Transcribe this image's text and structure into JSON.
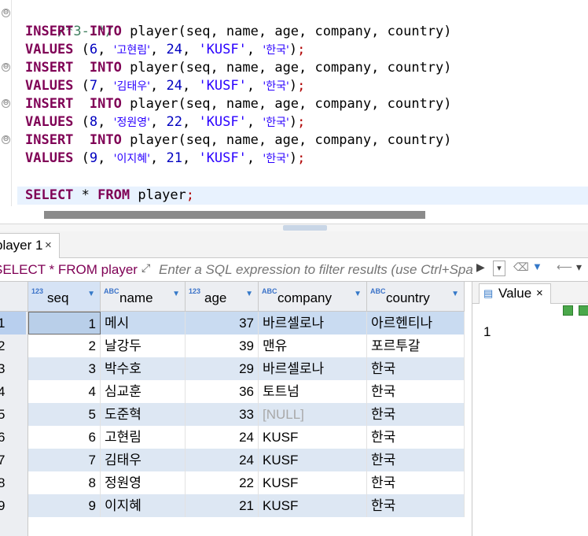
{
  "editor": {
    "comment": "/*3-1*/",
    "lines": [
      {
        "kw1": "INSERT",
        "kw2": "INTO",
        "rest": "player(seq, name, age, company, country)"
      },
      {
        "kw": "VALUES",
        "open": "(",
        "num1": "6",
        "str1": "'고현림'",
        "num2": "24",
        "str2": "'KUSF'",
        "str3": "'한국'",
        "close": ")",
        "semi": ";"
      },
      {
        "kw1": "INSERT",
        "kw2": "INTO",
        "rest": "player(seq, name, age, company, country)"
      },
      {
        "kw": "VALUES",
        "open": "(",
        "num1": "7",
        "str1": "'김태우'",
        "num2": "24",
        "str2": "'KUSF'",
        "str3": "'한국'",
        "close": ")",
        "semi": ";"
      },
      {
        "kw1": "INSERT",
        "kw2": "INTO",
        "rest": "player(seq, name, age, company, country)"
      },
      {
        "kw": "VALUES",
        "open": "(",
        "num1": "8",
        "str1": "'정원영'",
        "num2": "22",
        "str2": "'KUSF'",
        "str3": "'한국'",
        "close": ")",
        "semi": ";"
      },
      {
        "kw1": "INSERT",
        "kw2": "INTO",
        "rest": "player(seq, name, age, company, country)"
      },
      {
        "kw": "VALUES",
        "open": "(",
        "num1": "9",
        "str1": "'이지혜'",
        "num2": "21",
        "str2": "'KUSF'",
        "str3": "'한국'",
        "close": ")",
        "semi": ";"
      }
    ],
    "select": {
      "kw1": "SELECT",
      "star": "*",
      "kw2": "FROM",
      "table": "player",
      "semi": ";"
    }
  },
  "result_tab": {
    "label": "player 1",
    "close": "×"
  },
  "filter": {
    "query_label": "SELECT * FROM player",
    "placeholder": "Enter a SQL expression to filter results (use Ctrl+Space)"
  },
  "grid": {
    "columns": [
      {
        "name": "seq",
        "type": "123"
      },
      {
        "name": "name",
        "type": "ABC"
      },
      {
        "name": "age",
        "type": "123"
      },
      {
        "name": "company",
        "type": "ABC"
      },
      {
        "name": "country",
        "type": "ABC"
      }
    ],
    "rows": [
      {
        "num": "1",
        "seq": "1",
        "name": "메시",
        "age": "37",
        "company": "바르셀로나",
        "country": "아르헨티나"
      },
      {
        "num": "2",
        "seq": "2",
        "name": "날강두",
        "age": "39",
        "company": "맨유",
        "country": "포르투갈"
      },
      {
        "num": "3",
        "seq": "3",
        "name": "박수호",
        "age": "29",
        "company": "바르셀로나",
        "country": "한국"
      },
      {
        "num": "4",
        "seq": "4",
        "name": "심교훈",
        "age": "36",
        "company": "토트넘",
        "country": "한국"
      },
      {
        "num": "5",
        "seq": "5",
        "name": "도준혁",
        "age": "33",
        "company": "[NULL]",
        "country": "한국"
      },
      {
        "num": "6",
        "seq": "6",
        "name": "고현림",
        "age": "24",
        "company": "KUSF",
        "country": "한국"
      },
      {
        "num": "7",
        "seq": "7",
        "name": "김태우",
        "age": "24",
        "company": "KUSF",
        "country": "한국"
      },
      {
        "num": "8",
        "seq": "8",
        "name": "정원영",
        "age": "22",
        "company": "KUSF",
        "country": "한국"
      },
      {
        "num": "9",
        "seq": "9",
        "name": "이지혜",
        "age": "21",
        "company": "KUSF",
        "country": "한국"
      }
    ]
  },
  "value_panel": {
    "tab_label": "Value",
    "close": "×",
    "value": "1"
  },
  "icons": {
    "fold": "⊖",
    "expand": "⤢",
    "run_filter": "▶",
    "history": "▾",
    "eraser": "⌫",
    "funnel": "▼",
    "back": "⟵",
    "menu": "▾",
    "sort": "▼",
    "value_tab": "▤"
  },
  "colors": {
    "keyword": "#7f0055",
    "string": "#2a00ff",
    "number": "#0000c0",
    "comment": "#3f7f5f",
    "selected_row": "#c9dbf1",
    "alt_row": "#dde7f3"
  }
}
